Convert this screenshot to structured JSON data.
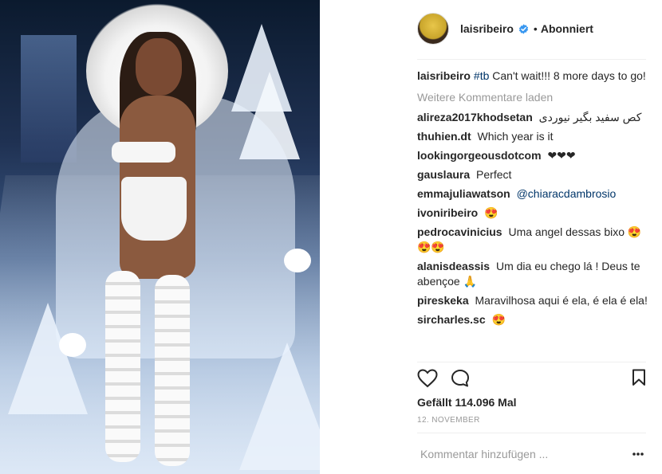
{
  "post": {
    "image_alt": "Laisribeiro runway photo",
    "header": {
      "username": "laisribeiro",
      "verified_icon": "verified-badge-icon",
      "dot": "•",
      "follow_status": "Abonniert"
    },
    "caption": {
      "user": "laisribeiro",
      "hashtag": "#tb",
      "text": "Can't wait!!! 8 more days to go!"
    },
    "load_more": "Weitere Kommentare laden",
    "comments": [
      {
        "user": "alireza2017khodsetan",
        "text": "کص سفید بگیر نیوردی"
      },
      {
        "user": "thuhien.dt",
        "text": "Which year is it"
      },
      {
        "user": "lookingorgeousdotcom",
        "text": "❤❤❤"
      },
      {
        "user": "gauslaura",
        "text": "Perfect"
      },
      {
        "user": "emmajuliawatson",
        "mention": "@chiaracdambrosio",
        "text": ""
      },
      {
        "user": "ivoniribeiro",
        "text": "😍"
      },
      {
        "user": "pedrocavinicius",
        "text": "Uma angel dessas bixo 😍😍😍"
      },
      {
        "user": "alanisdeassis",
        "text": "Um dia eu chego lá ! Deus te abençoe 🙏"
      },
      {
        "user": "pireskeka",
        "text": "Maravilhosa aqui é ela, é ela é ela!"
      },
      {
        "user": "sircharles.sc",
        "text": "😍"
      }
    ],
    "likes": "Gefällt 114.096 Mal",
    "date": "12. NOVEMBER",
    "add_comment_placeholder": "Kommentar hinzufügen ...",
    "icons": {
      "like": "heart-icon",
      "comment": "comment-icon",
      "save": "bookmark-icon",
      "more": "more-options-icon"
    }
  }
}
